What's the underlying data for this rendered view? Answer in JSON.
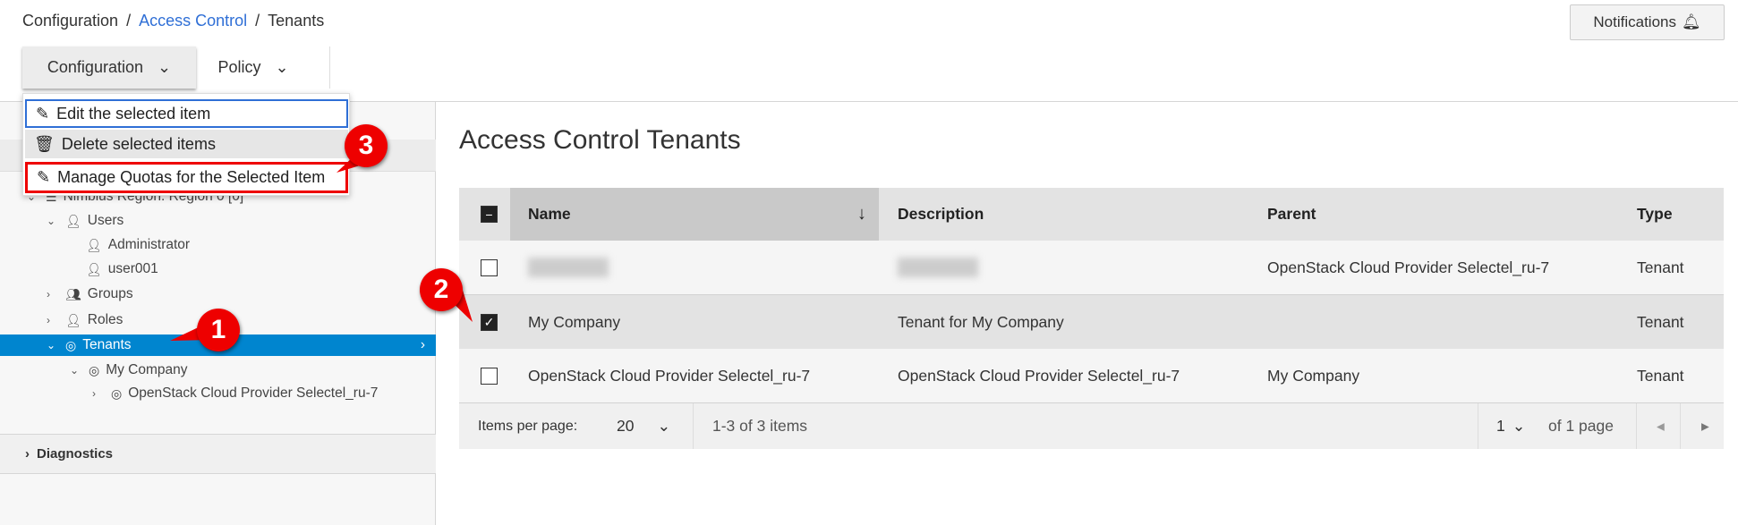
{
  "breadcrumb": [
    "Configuration",
    "Access Control",
    "Tenants"
  ],
  "notifications": {
    "label": "Notifications",
    "icon": "bell-icon"
  },
  "toolbar": {
    "configuration": "Configuration",
    "policy": "Policy"
  },
  "menu": {
    "items": [
      {
        "label": "Edit the selected item",
        "icon": "pencil-icon"
      },
      {
        "label": "Delete selected items",
        "icon": "trash-icon"
      },
      {
        "label": "Manage Quotas for the Selected Item",
        "icon": "pencil-icon"
      }
    ]
  },
  "tree": {
    "items": [
      "Nimbius Region: Region 0 [0]",
      "Users",
      "Administrator",
      "user001",
      "Groups",
      "Roles",
      "Tenants",
      "My Company",
      "OpenStack Cloud Provider Selectel_ru-7"
    ],
    "diagnostics": "Diagnostics"
  },
  "main": {
    "title": "Access Control Tenants"
  },
  "table": {
    "headers": [
      "Name",
      "Description",
      "Parent",
      "Type"
    ],
    "rows": [
      {
        "name": "",
        "description": "",
        "parent": "OpenStack Cloud Provider Selectel_ru-7",
        "type": "Tenant",
        "checked": false
      },
      {
        "name": "My Company",
        "description": "Tenant for My Company",
        "parent": "",
        "type": "Tenant",
        "checked": true
      },
      {
        "name": "OpenStack Cloud Provider Selectel_ru-7",
        "description": "OpenStack Cloud Provider Selectel_ru-7",
        "parent": "My Company",
        "type": "Tenant",
        "checked": false
      }
    ]
  },
  "pagination": {
    "items_per_page_label": "Items per page:",
    "items_per_page": "20",
    "range": "1-3 of 3 items",
    "page": "1",
    "of_pages": "of 1 page"
  },
  "annotations": [
    "1",
    "2",
    "3"
  ],
  "colors": {
    "selected": "#0085cf",
    "link": "#2f6fd6",
    "annotation": "#e00000"
  }
}
